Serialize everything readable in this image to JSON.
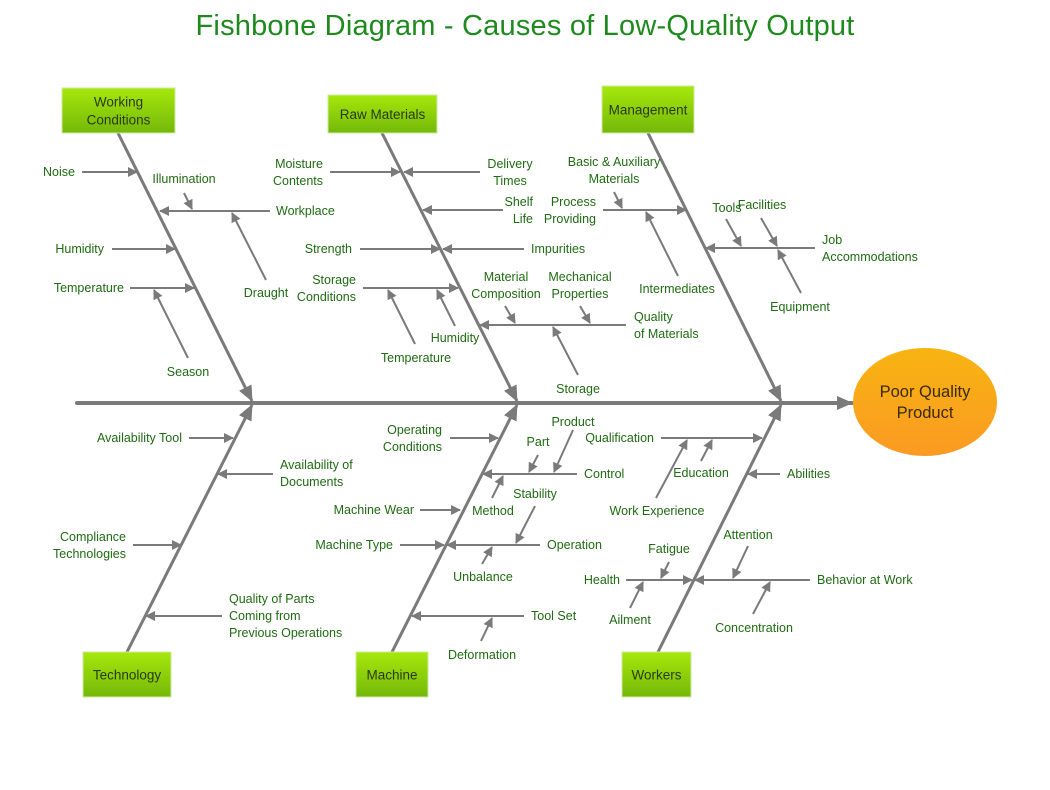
{
  "title": "Fishbone Diagram - Causes of Low-Quality Output",
  "effect": {
    "lines": [
      "Poor Quality",
      "Product"
    ]
  },
  "colors": {
    "title": "#1e8a1e",
    "label": "#1f6b12",
    "line": "#7a7a7a",
    "category_fill_top": "#a6e80b",
    "category_fill_bottom": "#74b80a",
    "effect_fill_top": "#f7b411",
    "effect_fill_bottom": "#fb9a22"
  },
  "categories": {
    "working_conditions": {
      "lines": [
        "Working",
        "Conditions"
      ]
    },
    "raw_materials": {
      "lines": [
        "Raw Materials"
      ]
    },
    "management": {
      "lines": [
        "Management"
      ]
    },
    "technology": {
      "lines": [
        "Technology"
      ]
    },
    "machine": {
      "lines": [
        "Machine"
      ]
    },
    "workers": {
      "lines": [
        "Workers"
      ]
    }
  },
  "causes": {
    "working_conditions": [
      {
        "lines": [
          "Noise"
        ]
      },
      {
        "lines": [
          "Workplace"
        ],
        "sub": [
          {
            "lines": [
              "Illumination"
            ]
          },
          {
            "lines": [
              "Draught"
            ]
          }
        ]
      },
      {
        "lines": [
          "Humidity"
        ]
      },
      {
        "lines": [
          "Temperature"
        ],
        "sub": [
          {
            "lines": [
              "Season"
            ]
          }
        ]
      }
    ],
    "raw_materials": [
      {
        "lines": [
          "Moisture",
          "Contents"
        ]
      },
      {
        "lines": [
          "Delivery",
          "Times"
        ]
      },
      {
        "lines": [
          "Shelf",
          "Life"
        ]
      },
      {
        "lines": [
          "Strength"
        ]
      },
      {
        "lines": [
          "Impurities"
        ]
      },
      {
        "lines": [
          "Storage",
          "Conditions"
        ],
        "sub": [
          {
            "lines": [
              "Temperature"
            ]
          },
          {
            "lines": [
              "Humidity"
            ]
          }
        ]
      },
      {
        "lines": [
          "Quality",
          "of Materials"
        ],
        "sub": [
          {
            "lines": [
              "Material",
              "Composition"
            ]
          },
          {
            "lines": [
              "Mechanical",
              "Properties"
            ]
          },
          {
            "lines": [
              "Storage"
            ]
          }
        ]
      }
    ],
    "management": [
      {
        "lines": [
          "Process",
          "Providing"
        ],
        "sub": [
          {
            "lines": [
              "Basic & Auxiliary",
              "Materials"
            ]
          },
          {
            "lines": [
              "Intermediates"
            ]
          }
        ]
      },
      {
        "lines": [
          "Job",
          "Accommodations"
        ],
        "sub": [
          {
            "lines": [
              "Tools"
            ]
          },
          {
            "lines": [
              "Facilities"
            ]
          },
          {
            "lines": [
              "Equipment"
            ]
          }
        ]
      }
    ],
    "technology": [
      {
        "lines": [
          "Availability Tool"
        ]
      },
      {
        "lines": [
          "Availability of",
          "Documents"
        ]
      },
      {
        "lines": [
          "Compliance",
          "Technologies"
        ]
      },
      {
        "lines": [
          "Quality of Parts",
          "Coming from",
          "Previous Operations"
        ]
      }
    ],
    "machine": [
      {
        "lines": [
          "Operating",
          "Conditions"
        ]
      },
      {
        "lines": [
          "Control"
        ],
        "sub": [
          {
            "lines": [
              "Part"
            ]
          },
          {
            "lines": [
              "Product"
            ]
          },
          {
            "lines": [
              "Method"
            ]
          }
        ]
      },
      {
        "lines": [
          "Machine Wear"
        ]
      },
      {
        "lines": [
          "Machine Type"
        ]
      },
      {
        "lines": [
          "Operation"
        ],
        "sub": [
          {
            "lines": [
              "Stability"
            ]
          },
          {
            "lines": [
              "Unbalance"
            ]
          }
        ]
      },
      {
        "lines": [
          "Tool Set"
        ],
        "sub": [
          {
            "lines": [
              "Deformation"
            ]
          }
        ]
      }
    ],
    "workers": [
      {
        "lines": [
          "Qualification"
        ],
        "sub": [
          {
            "lines": [
              "Work Experience"
            ]
          },
          {
            "lines": [
              "Education"
            ]
          }
        ]
      },
      {
        "lines": [
          "Abilities"
        ]
      },
      {
        "lines": [
          "Health"
        ],
        "sub": [
          {
            "lines": [
              "Fatigue"
            ]
          },
          {
            "lines": [
              "Ailment"
            ]
          }
        ]
      },
      {
        "lines": [
          "Behavior at Work"
        ],
        "sub": [
          {
            "lines": [
              "Attention"
            ]
          },
          {
            "lines": [
              "Concentration"
            ]
          }
        ]
      }
    ]
  }
}
